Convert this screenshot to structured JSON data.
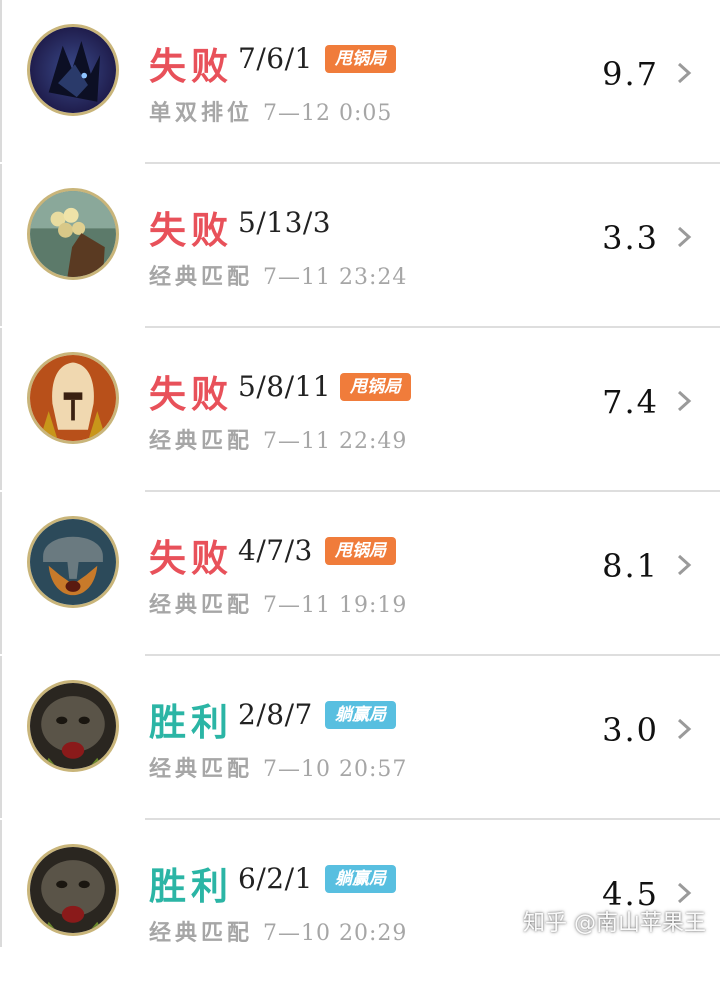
{
  "matches": [
    {
      "result": "失败",
      "outcome": "loss",
      "kda": "7/6/1",
      "badge": "甩锅局",
      "badge_type": "carry",
      "mode": "单双排位",
      "time": "7—12 0:05",
      "score": "9.7",
      "avatar": "dark-spiky-champion-avatar"
    },
    {
      "result": "失败",
      "outcome": "loss",
      "kda": "5/13/3",
      "badge": "",
      "badge_type": "",
      "mode": "经典匹配",
      "time": "7—11 23:24",
      "score": "3.3",
      "avatar": "gold-gauntlet-champion-avatar"
    },
    {
      "result": "失败",
      "outcome": "loss",
      "kda": "5/8/11",
      "badge": "甩锅局",
      "badge_type": "carry",
      "mode": "经典匹配",
      "time": "7—11 22:49",
      "score": "7.4",
      "avatar": "spartan-helmet-champion-avatar"
    },
    {
      "result": "失败",
      "outcome": "loss",
      "kda": "4/7/3",
      "badge": "甩锅局",
      "badge_type": "carry",
      "mode": "经典匹配",
      "time": "7—11 19:19",
      "score": "8.1",
      "avatar": "viking-helmet-champion-avatar"
    },
    {
      "result": "胜利",
      "outcome": "win",
      "kda": "2/8/7",
      "badge": "躺赢局",
      "badge_type": "lie",
      "mode": "经典匹配",
      "time": "7—10 20:57",
      "score": "3.0",
      "avatar": "dark-beast-champion-avatar"
    },
    {
      "result": "胜利",
      "outcome": "win",
      "kda": "6/2/1",
      "badge": "躺赢局",
      "badge_type": "lie",
      "mode": "经典匹配",
      "time": "7—10 20:29",
      "score": "4.5",
      "avatar": "dark-beast-champion-avatar"
    }
  ],
  "watermark": "知乎 @南山苹果王",
  "colors": {
    "loss": "#e8515a",
    "win": "#2bb5a5",
    "carry_badge": "#f07c3b",
    "lie_badge": "#58bfe0",
    "avatar_ring": "#c9b57a"
  }
}
